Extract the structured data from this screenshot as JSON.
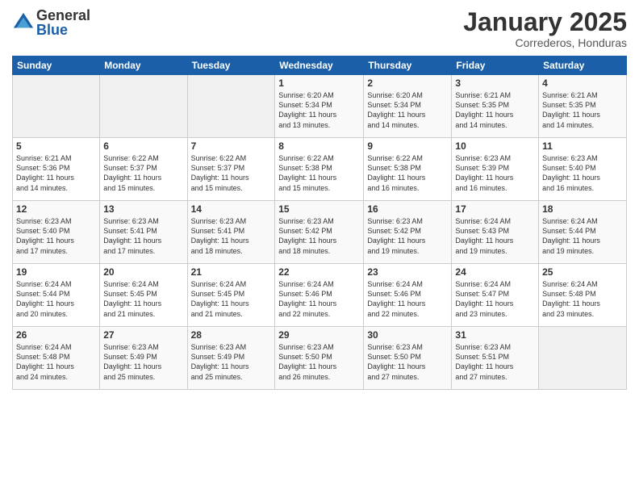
{
  "logo": {
    "general": "General",
    "blue": "Blue"
  },
  "title": "January 2025",
  "location": "Correderos, Honduras",
  "weekdays": [
    "Sunday",
    "Monday",
    "Tuesday",
    "Wednesday",
    "Thursday",
    "Friday",
    "Saturday"
  ],
  "weeks": [
    [
      {
        "day": "",
        "info": ""
      },
      {
        "day": "",
        "info": ""
      },
      {
        "day": "",
        "info": ""
      },
      {
        "day": "1",
        "info": "Sunrise: 6:20 AM\nSunset: 5:34 PM\nDaylight: 11 hours\nand 13 minutes."
      },
      {
        "day": "2",
        "info": "Sunrise: 6:20 AM\nSunset: 5:34 PM\nDaylight: 11 hours\nand 14 minutes."
      },
      {
        "day": "3",
        "info": "Sunrise: 6:21 AM\nSunset: 5:35 PM\nDaylight: 11 hours\nand 14 minutes."
      },
      {
        "day": "4",
        "info": "Sunrise: 6:21 AM\nSunset: 5:35 PM\nDaylight: 11 hours\nand 14 minutes."
      }
    ],
    [
      {
        "day": "5",
        "info": "Sunrise: 6:21 AM\nSunset: 5:36 PM\nDaylight: 11 hours\nand 14 minutes."
      },
      {
        "day": "6",
        "info": "Sunrise: 6:22 AM\nSunset: 5:37 PM\nDaylight: 11 hours\nand 15 minutes."
      },
      {
        "day": "7",
        "info": "Sunrise: 6:22 AM\nSunset: 5:37 PM\nDaylight: 11 hours\nand 15 minutes."
      },
      {
        "day": "8",
        "info": "Sunrise: 6:22 AM\nSunset: 5:38 PM\nDaylight: 11 hours\nand 15 minutes."
      },
      {
        "day": "9",
        "info": "Sunrise: 6:22 AM\nSunset: 5:38 PM\nDaylight: 11 hours\nand 16 minutes."
      },
      {
        "day": "10",
        "info": "Sunrise: 6:23 AM\nSunset: 5:39 PM\nDaylight: 11 hours\nand 16 minutes."
      },
      {
        "day": "11",
        "info": "Sunrise: 6:23 AM\nSunset: 5:40 PM\nDaylight: 11 hours\nand 16 minutes."
      }
    ],
    [
      {
        "day": "12",
        "info": "Sunrise: 6:23 AM\nSunset: 5:40 PM\nDaylight: 11 hours\nand 17 minutes."
      },
      {
        "day": "13",
        "info": "Sunrise: 6:23 AM\nSunset: 5:41 PM\nDaylight: 11 hours\nand 17 minutes."
      },
      {
        "day": "14",
        "info": "Sunrise: 6:23 AM\nSunset: 5:41 PM\nDaylight: 11 hours\nand 18 minutes."
      },
      {
        "day": "15",
        "info": "Sunrise: 6:23 AM\nSunset: 5:42 PM\nDaylight: 11 hours\nand 18 minutes."
      },
      {
        "day": "16",
        "info": "Sunrise: 6:23 AM\nSunset: 5:42 PM\nDaylight: 11 hours\nand 19 minutes."
      },
      {
        "day": "17",
        "info": "Sunrise: 6:24 AM\nSunset: 5:43 PM\nDaylight: 11 hours\nand 19 minutes."
      },
      {
        "day": "18",
        "info": "Sunrise: 6:24 AM\nSunset: 5:44 PM\nDaylight: 11 hours\nand 19 minutes."
      }
    ],
    [
      {
        "day": "19",
        "info": "Sunrise: 6:24 AM\nSunset: 5:44 PM\nDaylight: 11 hours\nand 20 minutes."
      },
      {
        "day": "20",
        "info": "Sunrise: 6:24 AM\nSunset: 5:45 PM\nDaylight: 11 hours\nand 21 minutes."
      },
      {
        "day": "21",
        "info": "Sunrise: 6:24 AM\nSunset: 5:45 PM\nDaylight: 11 hours\nand 21 minutes."
      },
      {
        "day": "22",
        "info": "Sunrise: 6:24 AM\nSunset: 5:46 PM\nDaylight: 11 hours\nand 22 minutes."
      },
      {
        "day": "23",
        "info": "Sunrise: 6:24 AM\nSunset: 5:46 PM\nDaylight: 11 hours\nand 22 minutes."
      },
      {
        "day": "24",
        "info": "Sunrise: 6:24 AM\nSunset: 5:47 PM\nDaylight: 11 hours\nand 23 minutes."
      },
      {
        "day": "25",
        "info": "Sunrise: 6:24 AM\nSunset: 5:48 PM\nDaylight: 11 hours\nand 23 minutes."
      }
    ],
    [
      {
        "day": "26",
        "info": "Sunrise: 6:24 AM\nSunset: 5:48 PM\nDaylight: 11 hours\nand 24 minutes."
      },
      {
        "day": "27",
        "info": "Sunrise: 6:23 AM\nSunset: 5:49 PM\nDaylight: 11 hours\nand 25 minutes."
      },
      {
        "day": "28",
        "info": "Sunrise: 6:23 AM\nSunset: 5:49 PM\nDaylight: 11 hours\nand 25 minutes."
      },
      {
        "day": "29",
        "info": "Sunrise: 6:23 AM\nSunset: 5:50 PM\nDaylight: 11 hours\nand 26 minutes."
      },
      {
        "day": "30",
        "info": "Sunrise: 6:23 AM\nSunset: 5:50 PM\nDaylight: 11 hours\nand 27 minutes."
      },
      {
        "day": "31",
        "info": "Sunrise: 6:23 AM\nSunset: 5:51 PM\nDaylight: 11 hours\nand 27 minutes."
      },
      {
        "day": "",
        "info": ""
      }
    ]
  ]
}
